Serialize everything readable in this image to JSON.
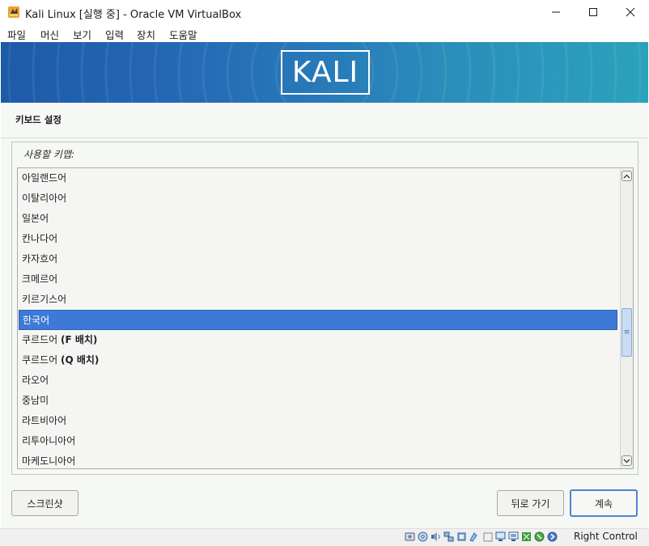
{
  "window": {
    "title": "Kali Linux [실행 중] - Oracle VM VirtualBox",
    "controls": [
      "minimize",
      "maximize",
      "close"
    ]
  },
  "menubar": {
    "items": [
      {
        "label": "파일"
      },
      {
        "label": "머신"
      },
      {
        "label": "보기"
      },
      {
        "label": "입력"
      },
      {
        "label": "장치"
      },
      {
        "label": "도움말"
      }
    ]
  },
  "banner": {
    "logo_text": "KALI"
  },
  "installer": {
    "page_title": "키보드 설정",
    "keymap_label": "사용할 키맵:",
    "keymaps": [
      {
        "name": "아일랜드어"
      },
      {
        "name": "이탈리아어"
      },
      {
        "name": "일본어"
      },
      {
        "name": "칸나다어"
      },
      {
        "name": "카자흐어"
      },
      {
        "name": "크메르어"
      },
      {
        "name": "키르기스어"
      },
      {
        "name": "한국어",
        "selected": true
      },
      {
        "name": "쿠르드어 ",
        "bold": "(F 배치)"
      },
      {
        "name": "쿠르드어 ",
        "bold": "(Q 배치)"
      },
      {
        "name": "라오어"
      },
      {
        "name": "중남미"
      },
      {
        "name": "라트비아어"
      },
      {
        "name": "리투아니아어"
      },
      {
        "name": "마케도니아어"
      }
    ],
    "screenshot_button": "스크린샷",
    "back_button": "뒤로 가기",
    "continue_button": "계속",
    "scroll_thumb_glyph": "≡"
  },
  "statusbar": {
    "icons": [
      "hard-disk-icon",
      "optical-drive-icon",
      "audio-icon",
      "network-icon",
      "usb-icon",
      "shared-folder-icon",
      "display-icon",
      "recording-icon",
      "cpu-icon",
      "mouse-integration-icon",
      "keyboard-icon"
    ],
    "host_key": "Right Control"
  },
  "colors": {
    "selection": "#3d7ad7",
    "banner_start": "#1d5aa8",
    "banner_end": "#2ba2bc",
    "installer_bg": "#f6f8f5"
  }
}
